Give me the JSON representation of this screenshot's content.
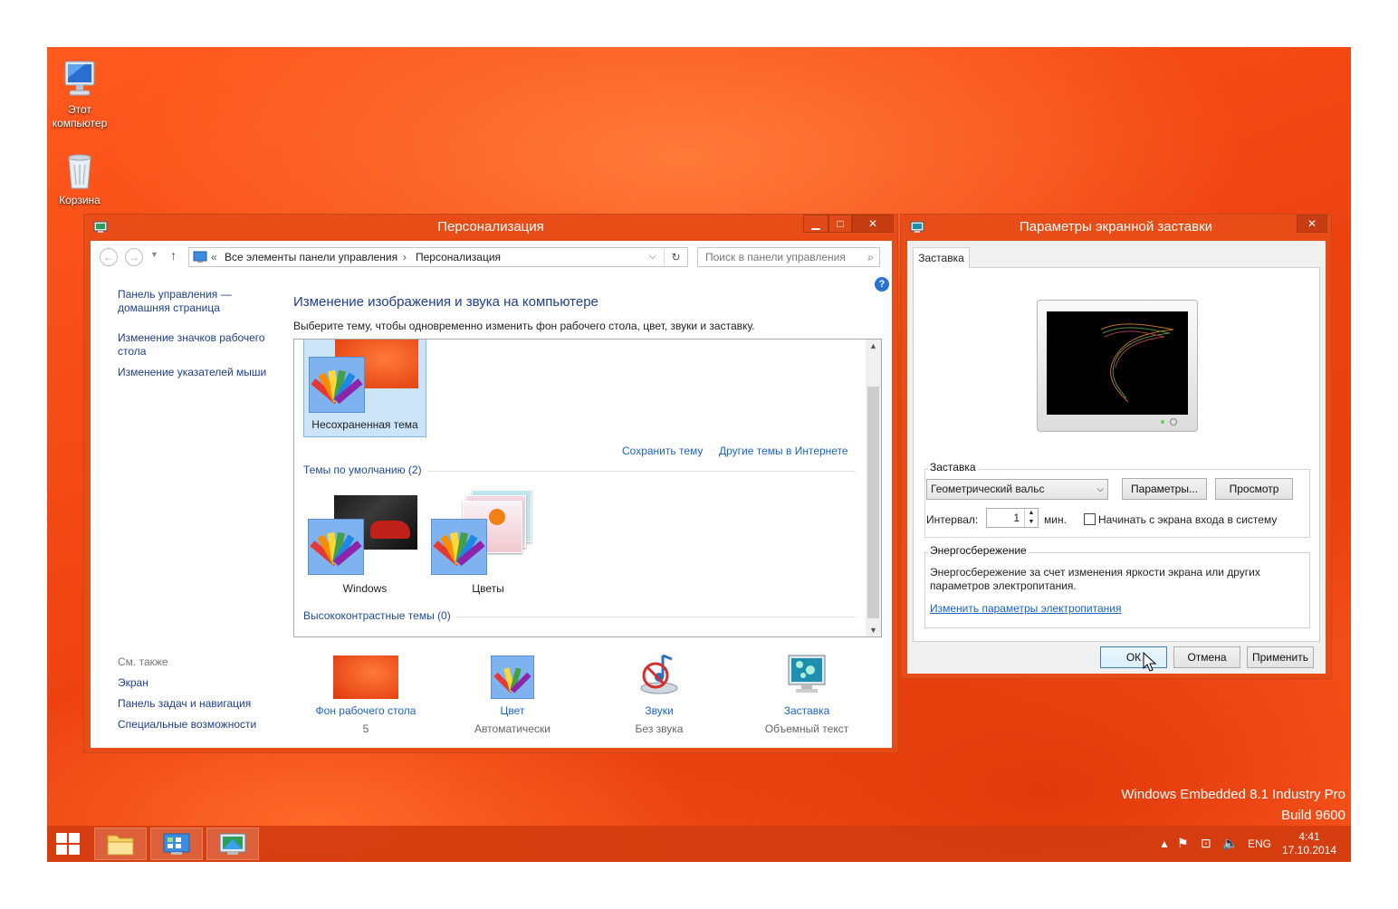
{
  "desktop": {
    "icons": [
      {
        "label_line1": "Этот",
        "label_line2": "компьютер",
        "icon": "computer-icon"
      },
      {
        "label_line1": "Корзина",
        "label_line2": "",
        "icon": "recycle-bin-icon"
      }
    ],
    "watermark_line1": "Windows Embedded 8.1 Industry Pro",
    "watermark_line2": "Build 9600"
  },
  "personalization": {
    "title": "Персонализация",
    "controls": {
      "minimize": "▁",
      "maximize": "□",
      "close": "✕"
    },
    "breadcrumb": {
      "prefix": "«",
      "item1": "Все элементы панели управления",
      "sep": "›",
      "item2": "Персонализация"
    },
    "search": {
      "placeholder": "Поиск в панели управления"
    },
    "help": "?",
    "sidebar": {
      "home_line1": "Панель управления —",
      "home_line2": "домашняя страница",
      "icons_line1": "Изменение значков рабочего",
      "icons_line2": "стола",
      "pointers": "Изменение указателей мыши",
      "see_also": "См. также",
      "screen": "Экран",
      "taskbar": "Панель задач и навигация",
      "accessibility": "Специальные возможности"
    },
    "heading": "Изменение изображения и звука на компьютере",
    "subheading": "Выберите тему, чтобы одновременно изменить фон рабочего стола, цвет, звуки и заставку.",
    "unsaved_theme": "Несохраненная тема",
    "save_theme": "Сохранить тему",
    "online_themes": "Другие темы в Интернете",
    "default_group": "Темы по умолчанию (2)",
    "themes": [
      "Windows",
      "Цветы"
    ],
    "contrast_group": "Высококонтрастные темы (0)",
    "bottom": [
      {
        "label": "Фон рабочего стола",
        "value": "5"
      },
      {
        "label": "Цвет",
        "value": "Автоматически"
      },
      {
        "label": "Звуки",
        "value": "Без звука"
      },
      {
        "label": "Заставка",
        "value": "Объемный текст"
      }
    ]
  },
  "screensaver": {
    "title": "Параметры экранной заставки",
    "close": "✕",
    "tab": "Заставка",
    "group_label": "Заставка",
    "selected": "Геометрический вальс",
    "settings_btn": "Параметры...",
    "preview_btn": "Просмотр",
    "interval_label": "Интервал:",
    "interval_value": "1",
    "minutes": "мин.",
    "logon_label": "Начинать с экрана входа в систему",
    "power_group": "Энергосбережение",
    "power_text_line1": "Энергосбережение за счет изменения яркости экрана или других",
    "power_text_line2": "параметров электропитания.",
    "power_link": "Изменить параметры электропитания",
    "ok": "ОК",
    "cancel": "Отмена",
    "apply": "Применить"
  },
  "taskbar": {
    "lang": "ENG",
    "time": "4:41",
    "date": "17.10.2014"
  }
}
